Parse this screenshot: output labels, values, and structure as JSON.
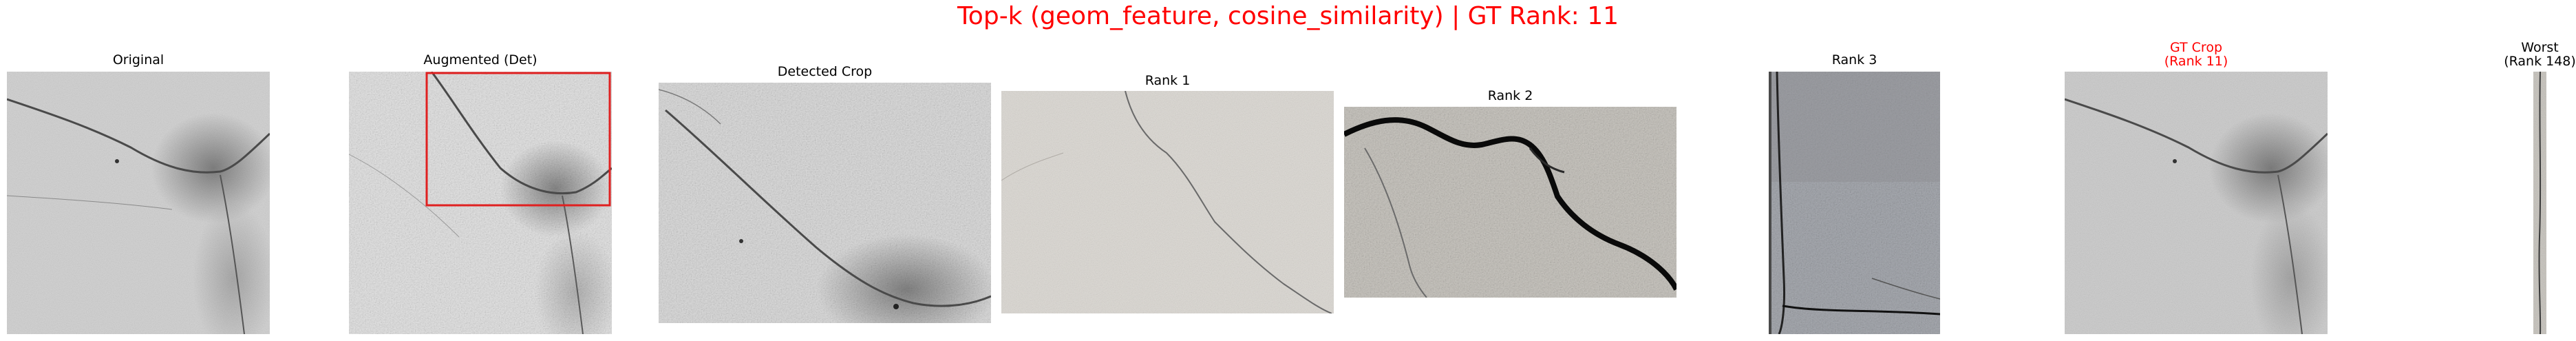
{
  "figure": {
    "title": "Top-k (geom_feature, cosine_similarity) | GT Rank: 11",
    "title_color": "#ff0000"
  },
  "panels": [
    {
      "title": "Original",
      "image": "wall-crack-photo"
    },
    {
      "title": "Augmented (Det)",
      "image": "wall-crack-photo-augmented",
      "box_color": "#e02020"
    },
    {
      "title": "Detected Crop",
      "image": "wall-crack-crop"
    },
    {
      "title": "Rank 1",
      "image": "thin-crack-wall"
    },
    {
      "title": "Rank 2",
      "image": "wide-black-crack-wall"
    },
    {
      "title": "Rank 3",
      "image": "concrete-wall-crack"
    },
    {
      "title_line1": "GT Crop",
      "title_line2": "(Rank 11)",
      "title_color": "#ff0000",
      "image": "wall-crack-photo"
    },
    {
      "title_line1": "Worst",
      "title_line2": "(Rank 148)",
      "image": "narrow-crack-strip"
    }
  ]
}
